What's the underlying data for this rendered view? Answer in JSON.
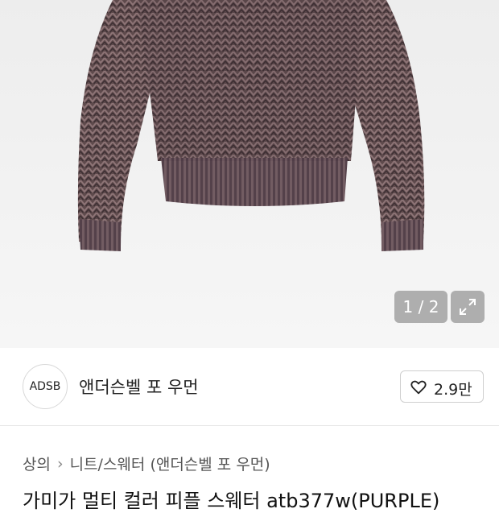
{
  "gallery": {
    "image_alt": "sweater product photo",
    "pager_text": "1 / 2",
    "expand_icon": "expand-icon"
  },
  "brand": {
    "logo_text": "ADSB",
    "name": "앤더슨벨 포 우먼",
    "like_icon": "heart-icon",
    "like_count": "2.9만"
  },
  "breadcrumb": {
    "items": [
      "상의",
      "니트/스웨터",
      "(앤더슨벨 포 우먼)"
    ],
    "separator_icon": "chevron-right-icon"
  },
  "product": {
    "title": "가미가 멀티 컬러 피플 스웨터 atb377w(PURPLE)"
  }
}
